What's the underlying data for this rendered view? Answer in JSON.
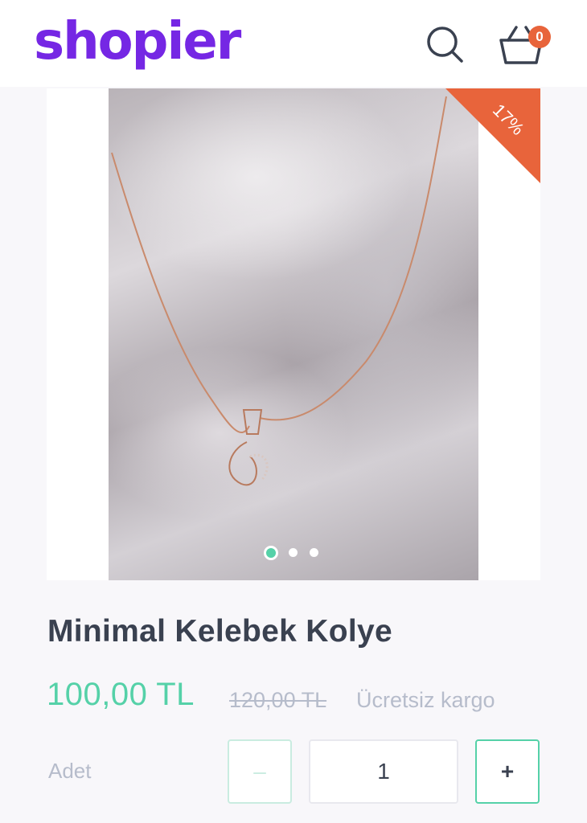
{
  "header": {
    "logo": "shopier",
    "search_icon": "search-icon",
    "cart_icon": "basket-icon",
    "cart_count": "0"
  },
  "gallery": {
    "discount_badge": "17%",
    "image_count": 3,
    "active_index": 0
  },
  "product": {
    "title": "Minimal Kelebek Kolye",
    "price": "100,00 TL",
    "old_price": "120,00 TL",
    "shipping": "Ücretsiz kargo"
  },
  "quantity": {
    "label": "Adet",
    "value": "1",
    "minus": "–",
    "plus": "+"
  },
  "colors": {
    "brand": "#7527e4",
    "accent": "#55d1a8",
    "discount": "#e8643b",
    "text_dark": "#3a4150",
    "text_muted": "#b6bccb"
  }
}
